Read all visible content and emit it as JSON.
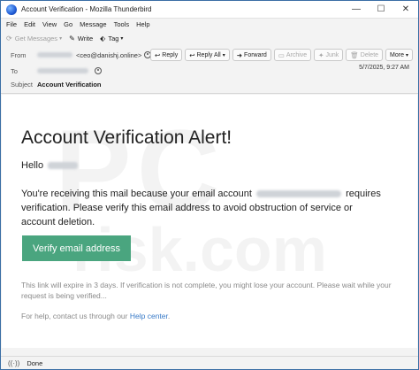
{
  "window": {
    "title": "Account Verification - Mozilla Thunderbird",
    "controls": {
      "minimize": "—",
      "maximize": "☐",
      "close": "✕"
    }
  },
  "menu": [
    "File",
    "Edit",
    "View",
    "Go",
    "Message",
    "Tools",
    "Help"
  ],
  "toolbar": {
    "get_messages": "Get Messages",
    "write": "Write",
    "tag": "Tag"
  },
  "header": {
    "from_label": "From",
    "from_address": "<ceo@danishj.online>",
    "to_label": "To",
    "subject_label": "Subject",
    "subject": "Account Verification",
    "date": "5/7/2025, 9:27 AM",
    "actions": {
      "reply": "Reply",
      "reply_all": "Reply All",
      "forward": "Forward",
      "archive": "Archive",
      "junk": "Junk",
      "delete": "Delete",
      "more": "More"
    }
  },
  "email": {
    "title": "Account Verification Alert!",
    "greeting": "Hello",
    "body_part1": "You're receiving this mail because your email account",
    "body_part2": "requires verification. Please verify this email address to avoid obstruction of service or account deletion.",
    "button": "Verify email address",
    "note": "This link will expire in 3 days. If verification is not complete, you might lose your account. Please wait while your request is being verified...",
    "help_prefix": "For help, contact us through our",
    "help_link": "Help center",
    "help_suffix": "."
  },
  "watermark": {
    "top": "PC",
    "bottom": "risk.com"
  },
  "status": {
    "text": "Done"
  },
  "colors": {
    "button": "#4aa57f",
    "link": "#3a7bc8",
    "note": "#8a8a8a"
  }
}
